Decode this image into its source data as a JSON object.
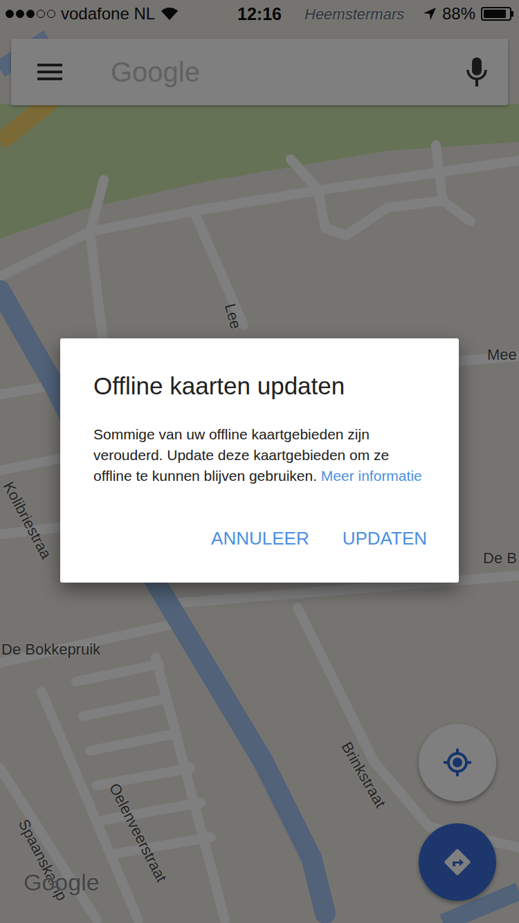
{
  "status_bar": {
    "carrier": "vodafone NL",
    "signal": {
      "level": 0.6
    },
    "time": "12:16",
    "battery": {
      "reading": "88%",
      "level": 0.88
    }
  },
  "search_bar": {
    "placeholder": "Google"
  },
  "map": {
    "labels": [
      {
        "text": "Heemstermars"
      },
      {
        "text": "Lee"
      },
      {
        "text": "Mee"
      },
      {
        "text": "Kolibriestraa"
      },
      {
        "text": "De B"
      },
      {
        "text": "De Bokkepruik"
      },
      {
        "text": "Brinkstraat"
      },
      {
        "text": "Oelenveerstraat"
      },
      {
        "text": "Spaanskamp"
      }
    ],
    "watermark": "Google"
  },
  "dialog": {
    "title": "Offline kaarten updaten",
    "body": "Sommige van uw offline kaartgebieden zijn verouderd. Update deze kaartgebieden om ze offline te kunnen blijven gebruiken.",
    "link": "Meer informatie",
    "buttons": [
      {
        "label": "ANNULEER"
      },
      {
        "label": "UPDATEN"
      }
    ]
  }
}
